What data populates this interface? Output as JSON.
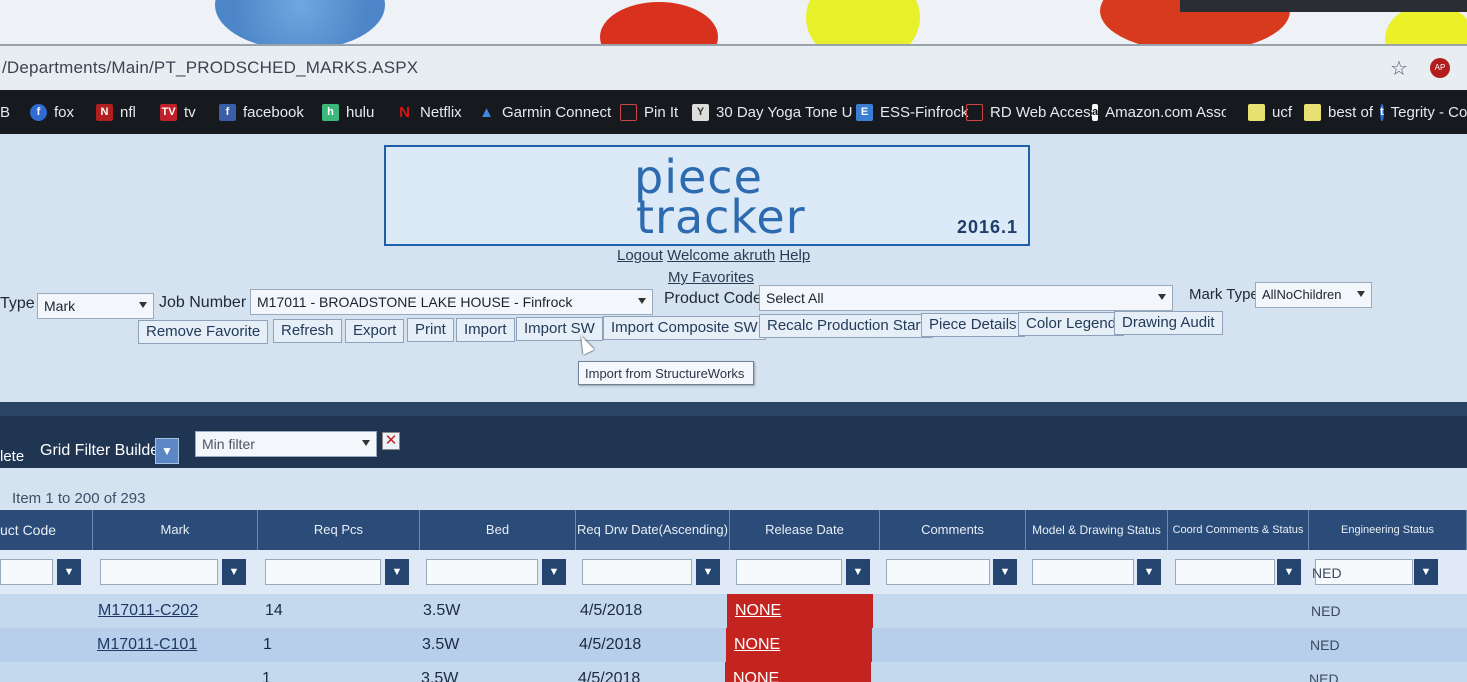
{
  "browser": {
    "address": "/Departments/Main/PT_PRODSCHED_MARKS.ASPX",
    "bookmarks": [
      {
        "label": "fox",
        "icon": "fox-icon"
      },
      {
        "label": "nfl",
        "icon": "nfl-icon"
      },
      {
        "label": "tv",
        "icon": "tv-icon"
      },
      {
        "label": "facebook",
        "icon": "facebook-icon"
      },
      {
        "label": "hulu",
        "icon": "hulu-icon"
      },
      {
        "label": "Netflix",
        "icon": "netflix-icon"
      },
      {
        "label": "Garmin Connect",
        "icon": "garmin-icon"
      },
      {
        "label": "Pin It",
        "icon": "bookmark-page-icon"
      },
      {
        "label": "30 Day Yoga Tone U",
        "icon": "yoga-icon"
      },
      {
        "label": "ESS-Finfrock",
        "icon": "ess-icon"
      },
      {
        "label": "RD Web Access",
        "icon": "bookmark-page-icon"
      },
      {
        "label": "Amazon.com Associ",
        "icon": "amazon-icon"
      },
      {
        "label": "ucf",
        "icon": "folder-icon"
      },
      {
        "label": "best of",
        "icon": "folder-icon"
      },
      {
        "label": "Tegrity - Co",
        "icon": "tegrity-icon"
      }
    ],
    "bookmark_first_fragment": "B"
  },
  "logo": {
    "line1": "piece",
    "line2": "tracker",
    "version": "2016.1"
  },
  "user_links": {
    "logout": "Logout",
    "welcome": "Welcome akruth",
    "help": "Help",
    "favorites": "My Favorites"
  },
  "filters": {
    "type_label": "Type",
    "type_value": "Mark",
    "job_label": "Job Number",
    "job_value": "M17011 - BROADSTONE LAKE HOUSE - Finfrock",
    "product_label": "Product Code",
    "product_value": "Select All",
    "mark_type_label": "Mark Type",
    "mark_type_value": "AllNoChildren"
  },
  "toolbar": {
    "remove_favorite": "Remove Favorite",
    "refresh": "Refresh",
    "export": "Export",
    "print": "Print",
    "import": "Import",
    "import_sw": "Import SW",
    "import_composite_sw": "Import Composite SW",
    "recalc": "Recalc Production Start",
    "piece_details": "Piece Details",
    "color_legend": "Color Legend",
    "drawing_audit": "Drawing Audit"
  },
  "tooltip": "Import from StructureWorks",
  "grid_toolbar": {
    "delete_fragment": "lete",
    "builder_label": "Grid Filter Builder",
    "filter_placeholder": "Min filter"
  },
  "item_count": "Item 1 to 200 of 293",
  "grid": {
    "columns": [
      "uct Code",
      "Mark",
      "Req Pcs",
      "Bed",
      "Req Drw Date(Ascending)",
      "Release Date",
      "Comments",
      "Model & Drawing Status",
      "Coord Comments & Status",
      "Engineering Status"
    ],
    "rows": [
      {
        "product": "",
        "mark": "",
        "req_pcs": "",
        "bed": "",
        "req_date": "",
        "release": "",
        "eng": "NED"
      },
      {
        "product": "",
        "mark": "M17011-C202",
        "req_pcs": "14",
        "bed": "3.5W",
        "req_date": "4/5/2018",
        "release": "NONE",
        "eng": "NED"
      },
      {
        "product": "",
        "mark": "M17011-C101",
        "req_pcs": "1",
        "bed": "3.5W",
        "req_date": "4/5/2018",
        "release": "NONE",
        "eng": "NED"
      },
      {
        "product": "",
        "mark": "",
        "req_pcs": "1",
        "bed": "3.5W",
        "req_date": "4/5/2018",
        "release": "NONE",
        "eng": "NED"
      }
    ]
  },
  "colors": {
    "none_badge": "#c3241f",
    "grid_header": "#2b4c78",
    "logo_blue": "#2d6bb0"
  }
}
